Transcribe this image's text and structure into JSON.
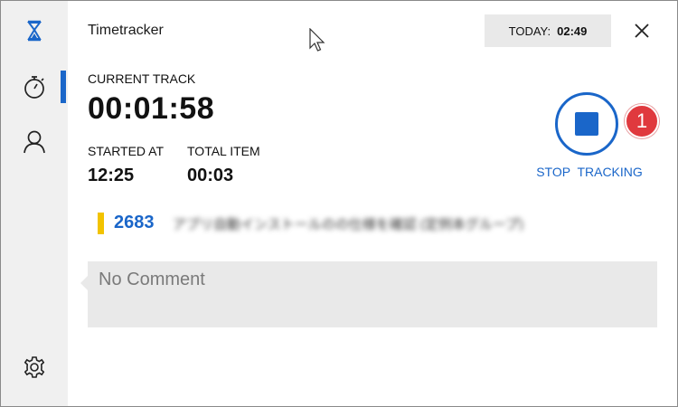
{
  "app": {
    "title": "Timetracker",
    "today_label": "TODAY:",
    "today_value": "02:49"
  },
  "sidebar": {
    "items": [
      {
        "icon": "hourglass-icon"
      },
      {
        "icon": "stopwatch-icon",
        "active": true
      },
      {
        "icon": "user-icon"
      },
      {
        "icon": "gear-icon"
      }
    ]
  },
  "current": {
    "label": "CURRENT TRACK",
    "time": "00:01:58",
    "started_label": "STARTED AT",
    "started_value": "12:25",
    "total_label": "TOTAL ITEM",
    "total_value": "00:03"
  },
  "stop": {
    "label": "STOP TRACKING",
    "badge": "1"
  },
  "task": {
    "id": "2683",
    "title_blurred": "アプリ自動インストールのの仕様を確認 (定例本グループ)"
  },
  "comment": {
    "placeholder": "No Comment"
  },
  "colors": {
    "accent": "#1a66c9",
    "badge": "#e0393e",
    "task_marker": "#f2c300",
    "sidebar_bg": "#f0f0f0"
  }
}
